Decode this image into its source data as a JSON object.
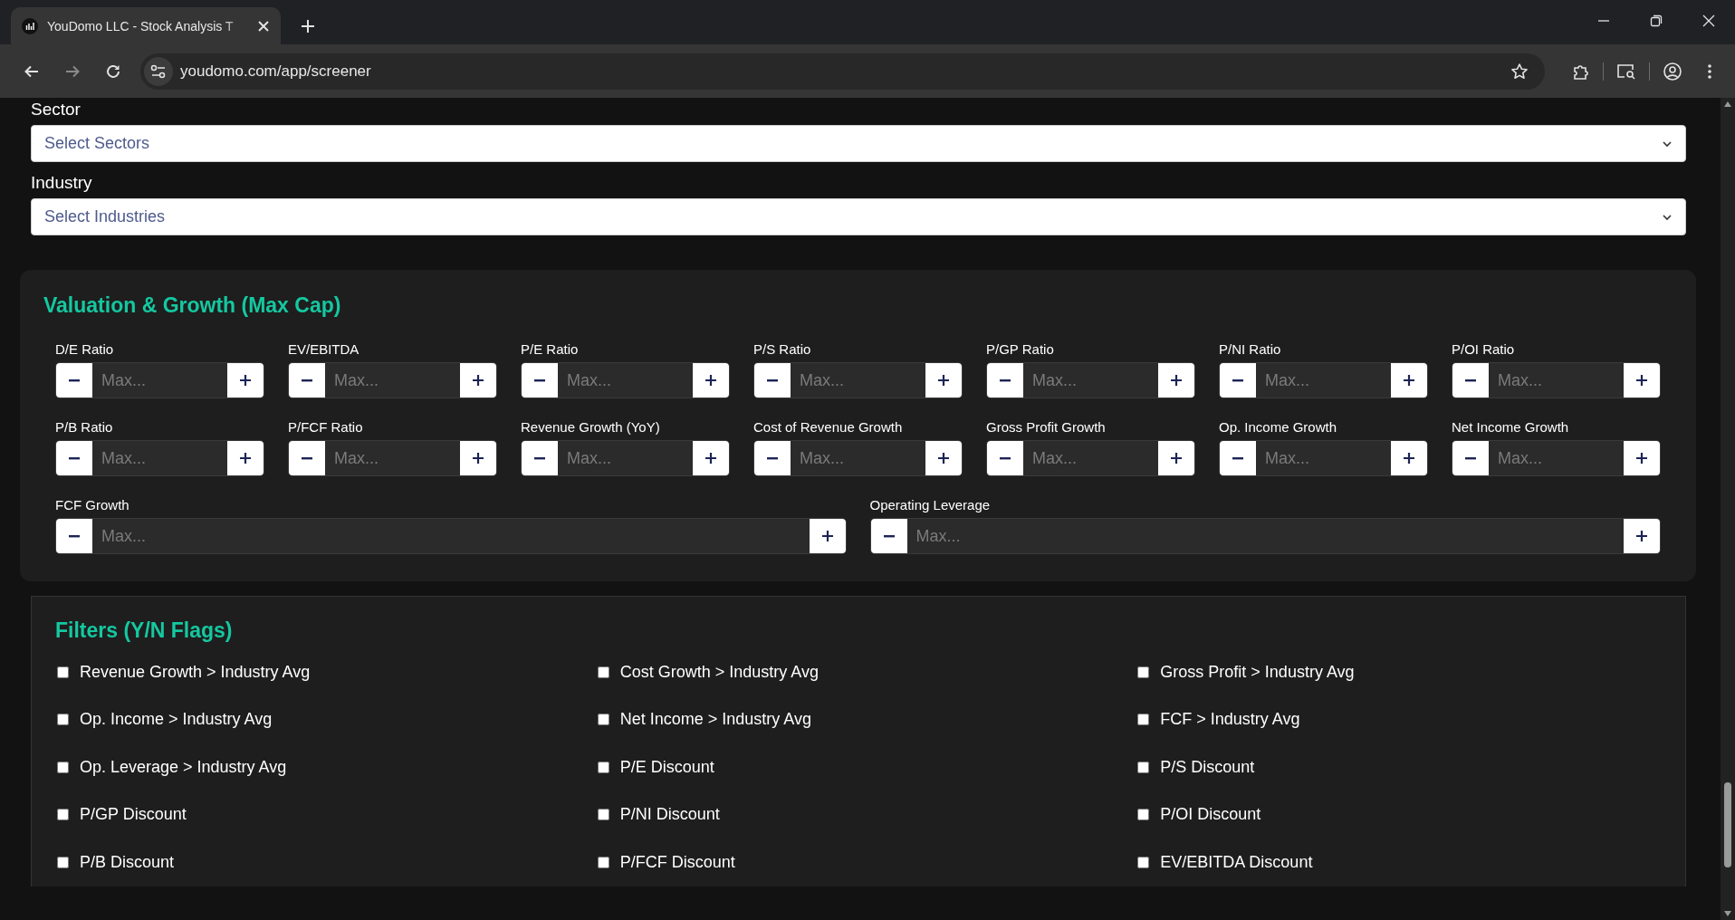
{
  "browser": {
    "tab_title": "YouDomo LLC - Stock Analysis T",
    "url": "youdomo.com/app/screener"
  },
  "selects": [
    {
      "label": "Sector",
      "placeholder": "Select Sectors"
    },
    {
      "label": "Industry",
      "placeholder": "Select Industries"
    }
  ],
  "valuation": {
    "title": "Valuation & Growth (Max Cap)",
    "rows": [
      [
        {
          "label": "D/E Ratio",
          "placeholder": "Max..."
        },
        {
          "label": "EV/EBITDA",
          "placeholder": "Max..."
        },
        {
          "label": "P/E Ratio",
          "placeholder": "Max..."
        },
        {
          "label": "P/S Ratio",
          "placeholder": "Max..."
        },
        {
          "label": "P/GP Ratio",
          "placeholder": "Max..."
        },
        {
          "label": "P/NI Ratio",
          "placeholder": "Max..."
        },
        {
          "label": "P/OI Ratio",
          "placeholder": "Max..."
        }
      ],
      [
        {
          "label": "P/B Ratio",
          "placeholder": "Max..."
        },
        {
          "label": "P/FCF Ratio",
          "placeholder": "Max..."
        },
        {
          "label": "Revenue Growth (YoY)",
          "placeholder": "Max..."
        },
        {
          "label": "Cost of Revenue Growth",
          "placeholder": "Max..."
        },
        {
          "label": "Gross Profit Growth",
          "placeholder": "Max..."
        },
        {
          "label": "Op. Income Growth",
          "placeholder": "Max..."
        },
        {
          "label": "Net Income Growth",
          "placeholder": "Max..."
        }
      ],
      [
        {
          "label": "FCF Growth",
          "placeholder": "Max..."
        },
        {
          "label": "Operating Leverage",
          "placeholder": "Max..."
        }
      ]
    ]
  },
  "filters": {
    "title": "Filters (Y/N Flags)",
    "items": [
      {
        "label": "Revenue Growth > Industry Avg",
        "checked": false
      },
      {
        "label": "Cost Growth > Industry Avg",
        "checked": false
      },
      {
        "label": "Gross Profit > Industry Avg",
        "checked": false
      },
      {
        "label": "Op. Income > Industry Avg",
        "checked": false
      },
      {
        "label": "Net Income > Industry Avg",
        "checked": false
      },
      {
        "label": "FCF > Industry Avg",
        "checked": false
      },
      {
        "label": "Op. Leverage > Industry Avg",
        "checked": false
      },
      {
        "label": "P/E Discount",
        "checked": false
      },
      {
        "label": "P/S Discount",
        "checked": false
      },
      {
        "label": "P/GP Discount",
        "checked": false
      },
      {
        "label": "P/NI Discount",
        "checked": false
      },
      {
        "label": "P/OI Discount",
        "checked": false
      },
      {
        "label": "P/B Discount",
        "checked": false
      },
      {
        "label": "P/FCF Discount",
        "checked": false
      },
      {
        "label": "EV/EBITDA Discount",
        "checked": false
      }
    ]
  }
}
